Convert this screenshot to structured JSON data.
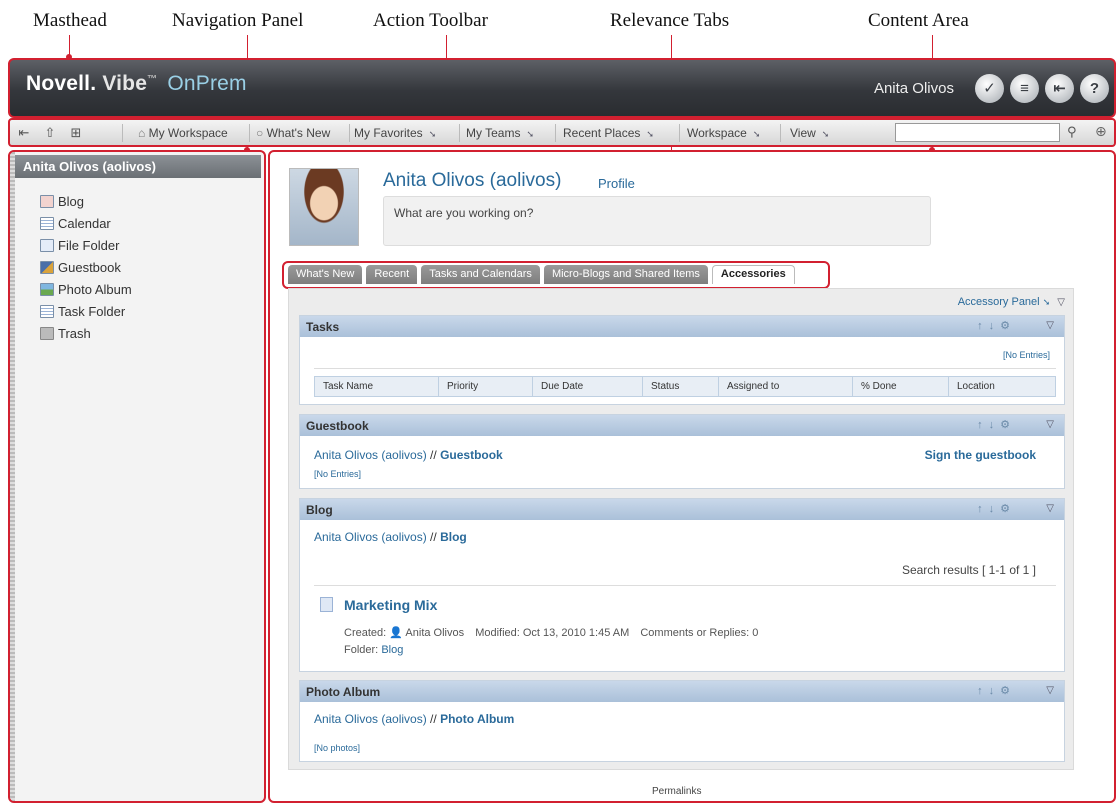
{
  "callouts": {
    "masthead": "Masthead",
    "navigation_panel": "Navigation Panel",
    "action_toolbar": "Action Toolbar",
    "relevance_tabs": "Relevance Tabs",
    "content_area": "Content Area"
  },
  "masthead": {
    "brand": "Novell.",
    "product": "Vibe",
    "tm": "™",
    "edition": "OnPrem",
    "user": "Anita Olivos",
    "buttons": [
      {
        "icon": "personal-prefs-icon",
        "glyph": "✓"
      },
      {
        "icon": "news-icon",
        "glyph": "≡"
      },
      {
        "icon": "logout-icon",
        "glyph": "⇤"
      },
      {
        "icon": "help-icon",
        "glyph": "?"
      }
    ]
  },
  "toolbar": {
    "items": [
      {
        "label": "My Workspace"
      },
      {
        "label": "What's New"
      },
      {
        "label": "My Favorites",
        "menu": "➘"
      },
      {
        "label": "My Teams",
        "menu": "➘"
      },
      {
        "label": "Recent Places",
        "menu": "➘"
      },
      {
        "label": "Workspace",
        "menu": "➘"
      },
      {
        "label": "View",
        "menu": "➘"
      }
    ],
    "search_value": ""
  },
  "nav": {
    "title": "Anita Olivos (aolivos)",
    "items": [
      {
        "label": "Blog",
        "icon": "blog-icon",
        "color": "#d9483b"
      },
      {
        "label": "Calendar",
        "icon": "calendar-icon",
        "color": "#3b6fb3"
      },
      {
        "label": "File Folder",
        "icon": "file-folder-icon",
        "color": "#6b8fcf"
      },
      {
        "label": "Guestbook",
        "icon": "guestbook-icon",
        "color": "#4a6fa8"
      },
      {
        "label": "Photo Album",
        "icon": "photo-album-icon",
        "color": "#4a9a4a"
      },
      {
        "label": "Task Folder",
        "icon": "task-folder-icon",
        "color": "#3b6fb3"
      },
      {
        "label": "Trash",
        "icon": "trash-icon",
        "color": "#8a8a8a"
      }
    ]
  },
  "profile": {
    "name": "Anita Olivos (aolivos)",
    "profile_link": "Profile",
    "status_placeholder": "What are you working on?"
  },
  "tabs": [
    {
      "label": "What's New",
      "active": false
    },
    {
      "label": "Recent",
      "active": false
    },
    {
      "label": "Tasks and Calendars",
      "active": false
    },
    {
      "label": "Micro-Blogs and Shared Items",
      "active": false
    },
    {
      "label": "Accessories",
      "active": true
    }
  ],
  "accessories": {
    "panel_link": "Accessory Panel",
    "tasks": {
      "title": "Tasks",
      "no_entries": "[No Entries]",
      "columns": [
        "Task Name",
        "Priority",
        "Due Date",
        "Status",
        "Assigned to",
        "% Done",
        "Location"
      ]
    },
    "guestbook": {
      "title": "Guestbook",
      "path_user": "Anita Olivos (aolivos)",
      "path_sep": " // ",
      "path_target": "Guestbook",
      "sign_link": "Sign the guestbook",
      "no_entries": "[No Entries]"
    },
    "blog": {
      "title": "Blog",
      "path_user": "Anita Olivos (aolivos)",
      "path_sep": " // ",
      "path_target": "Blog",
      "results": "Search results [ 1-1 of 1 ]",
      "entry_title": "Marketing Mix",
      "created_label": "Created:",
      "author": "Anita Olivos",
      "modified": "Modified: Oct 13, 2010 1:45 AM",
      "comments": "Comments or Replies: 0",
      "folder_label": "Folder:",
      "folder": "Blog"
    },
    "photo_album": {
      "title": "Photo Album",
      "path_user": "Anita Olivos (aolivos)",
      "path_sep": " // ",
      "path_target": "Photo Album",
      "no_photos": "[No photos]"
    }
  },
  "permalinks": "Permalinks"
}
